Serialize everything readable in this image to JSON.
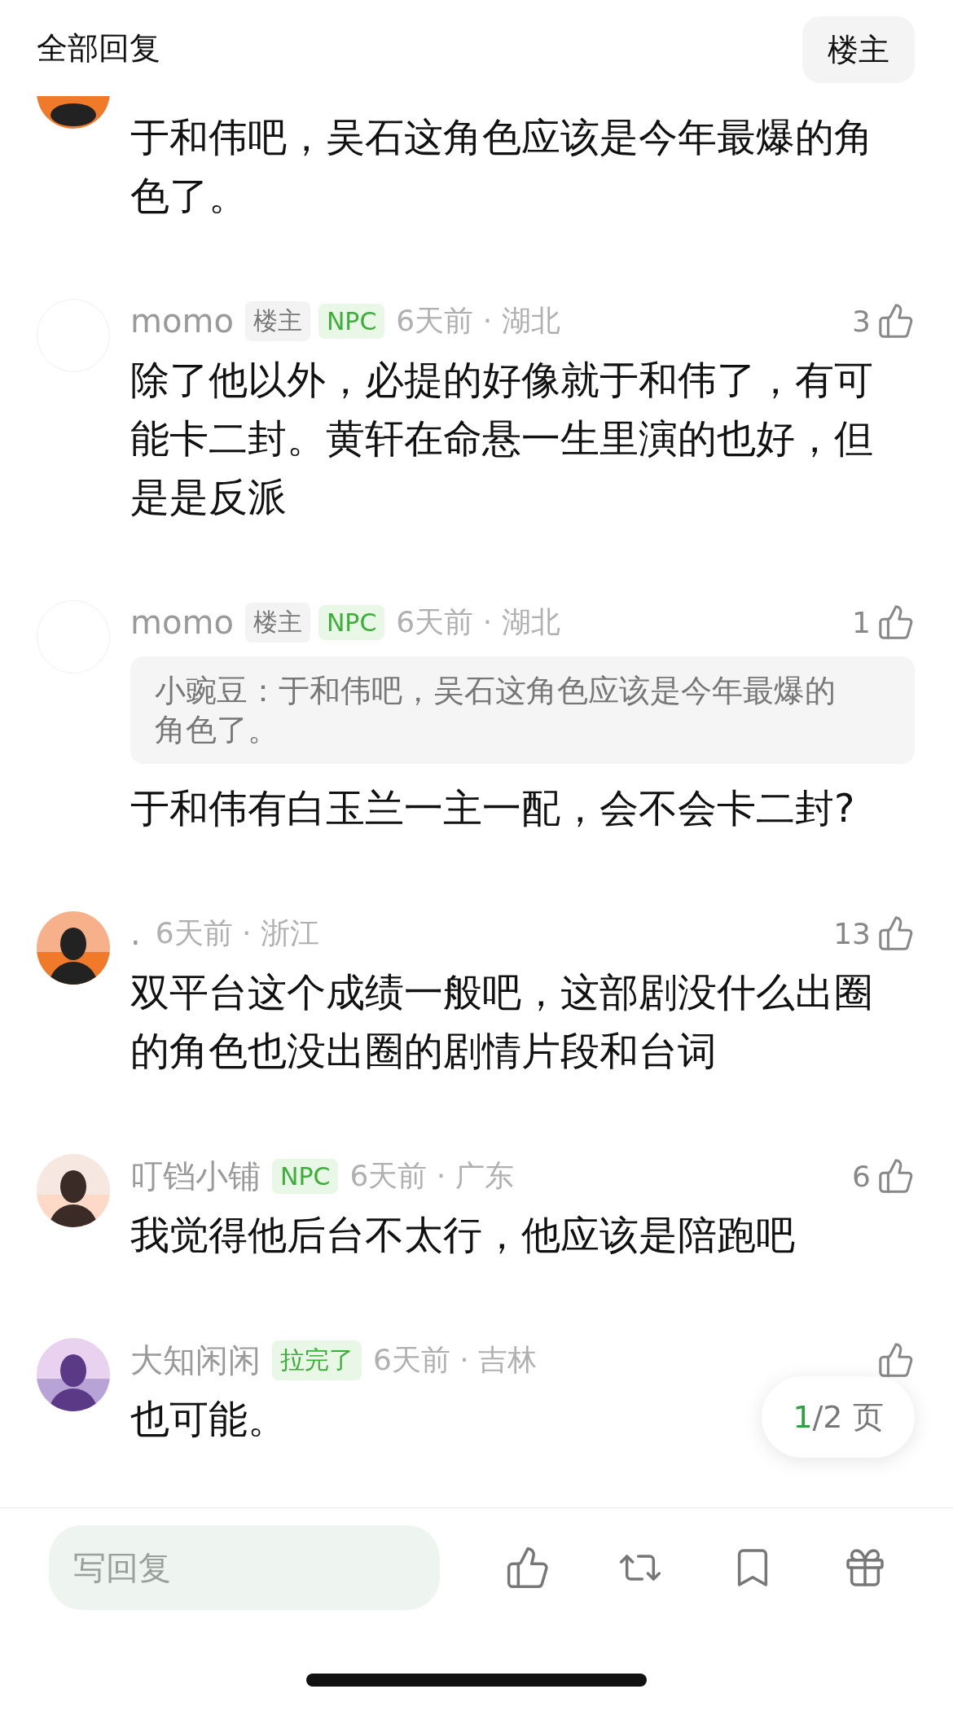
{
  "header": {
    "title": "全部回复",
    "filter_button": "楼主"
  },
  "comments": [
    {
      "kind": "partial",
      "text": "于和伟吧，吴石这角色应该是今年最爆的角色了。"
    },
    {
      "kind": "full",
      "avatar": {
        "kind": "blank"
      },
      "name": "momo",
      "badges": [
        {
          "label": "楼主",
          "kind": "op"
        },
        {
          "label": "NPC",
          "kind": "npc"
        }
      ],
      "meta": "6天前 · 湖北",
      "likes": "3",
      "text": "除了他以外，必提的好像就于和伟了，有可能卡二封。黄轩在命悬一生里演的也好，但是是反派"
    },
    {
      "kind": "full",
      "avatar": {
        "kind": "blank"
      },
      "name": "momo",
      "badges": [
        {
          "label": "楼主",
          "kind": "op"
        },
        {
          "label": "NPC",
          "kind": "npc"
        }
      ],
      "meta": "6天前 · 湖北",
      "likes": "1",
      "quote": "小豌豆：于和伟吧，吴石这角色应该是今年最爆的角色了。",
      "text": "于和伟有白玉兰一主一配，会不会卡二封?"
    },
    {
      "kind": "full",
      "avatar": {
        "kind": "picture"
      },
      "name": ".",
      "meta": "6天前 · 浙江",
      "likes": "13",
      "text": "双平台这个成绩一般吧，这部剧没什么出圈的角色也没出圈的剧情片段和台词"
    },
    {
      "kind": "full",
      "avatar": {
        "kind": "picture"
      },
      "name": "叮铛小铺",
      "badges": [
        {
          "label": "NPC",
          "kind": "npc"
        }
      ],
      "meta": "6天前 · 广东",
      "likes": "6",
      "text": "我觉得他后台不太行，他应该是陪跑吧"
    },
    {
      "kind": "full",
      "avatar": {
        "kind": "picture"
      },
      "name": "大知闲闲",
      "badges": [
        {
          "label": "拉完了",
          "kind": "tag"
        }
      ],
      "meta": "6天前 · 吉林",
      "text": "也可能。"
    }
  ],
  "pager": {
    "current": "1",
    "rest": "/2 页"
  },
  "reply_bar": {
    "placeholder": "写回复"
  }
}
